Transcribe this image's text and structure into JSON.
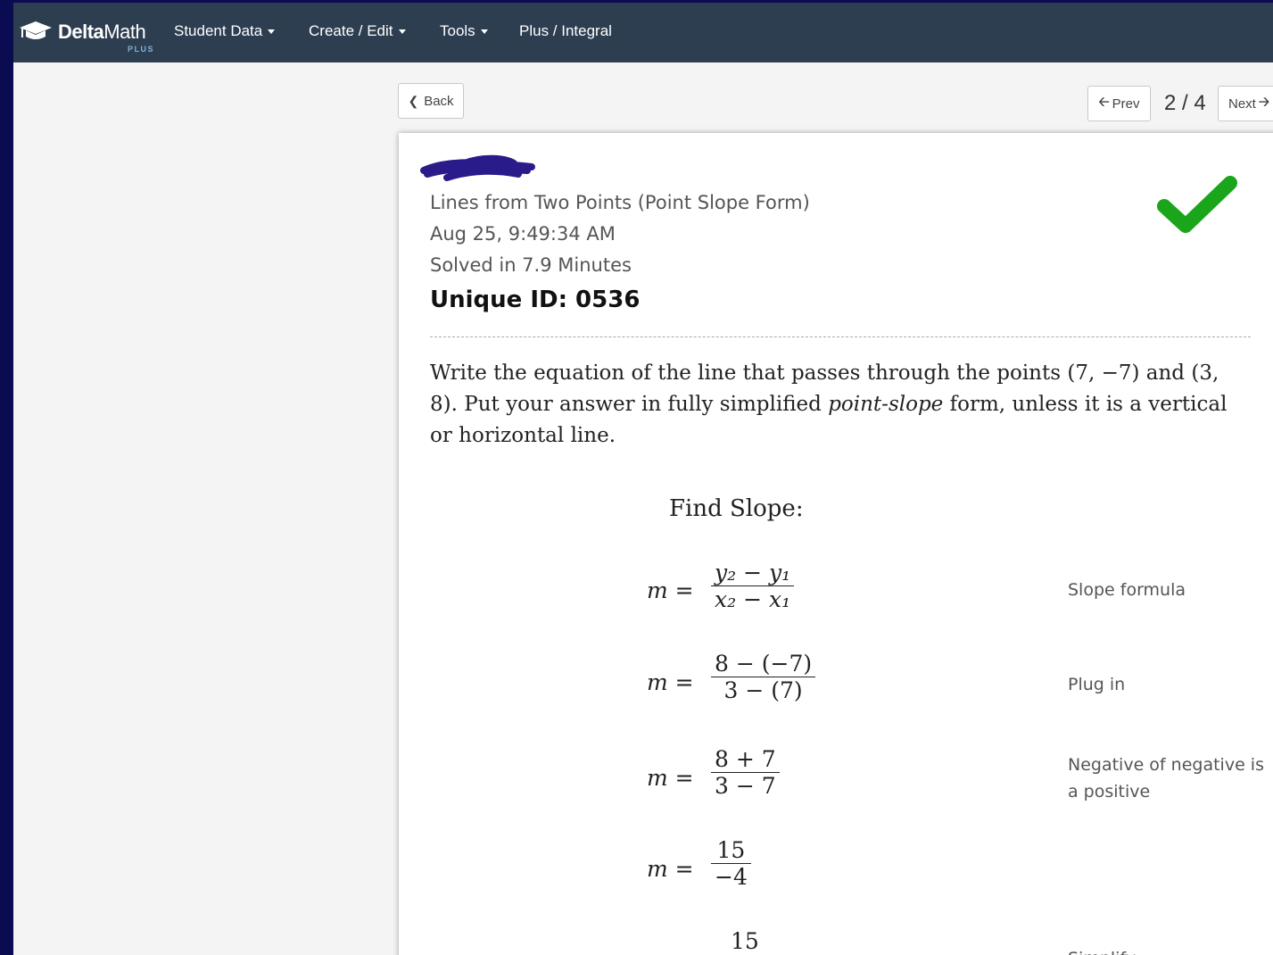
{
  "navbar": {
    "brand": {
      "name_bold": "Delta",
      "name_light": "Math",
      "sub": "PLUS"
    },
    "items": [
      {
        "label": "Student Data"
      },
      {
        "label": "Create / Edit"
      },
      {
        "label": "Tools"
      },
      {
        "label": "Plus / Integral"
      }
    ]
  },
  "controls": {
    "back_label": "Back",
    "prev_label": "Prev",
    "next_label": "Next",
    "page_counter": "2 / 4"
  },
  "card": {
    "assignment_title": "Lines from Two Points (Point Slope Form)",
    "timestamp": "Aug 25, 9:49:34 AM",
    "solved_time": "Solved in 7.9 Minutes",
    "unique_id": "Unique ID: 0536",
    "status": "correct",
    "question": {
      "prefix": "Write the equation of the line that passes through the points ",
      "point1": "(7, −7)",
      "and": " and ",
      "point2": "(3, 8)",
      "mid": ". Put your answer in fully simplified ",
      "emph": "point-slope",
      "suffix": " form, unless it is a vertical or horizontal line."
    },
    "find_slope_label": "Find Slope:",
    "steps": [
      {
        "lhs": "m =",
        "numerator": "y₂ − y₁",
        "denominator": "x₂ − x₁",
        "explanation": "Slope formula"
      },
      {
        "lhs": "m =",
        "numerator": "8 − (−7)",
        "denominator": "3 − (7)",
        "explanation": "Plug in"
      },
      {
        "lhs": "m =",
        "numerator": "8 + 7",
        "denominator": "3 − 7",
        "explanation": "Negative of negative is a positive"
      },
      {
        "lhs": "m =",
        "numerator": "15",
        "denominator": "−4",
        "explanation": ""
      },
      {
        "lhs": "",
        "numerator": "15",
        "denominator": "",
        "explanation": "Simplify"
      }
    ]
  },
  "colors": {
    "navbar_bg": "#2c3e50",
    "check_green": "#1aa51a",
    "outer_bg": "#0b0b52",
    "redaction": "#2a1b8a"
  }
}
